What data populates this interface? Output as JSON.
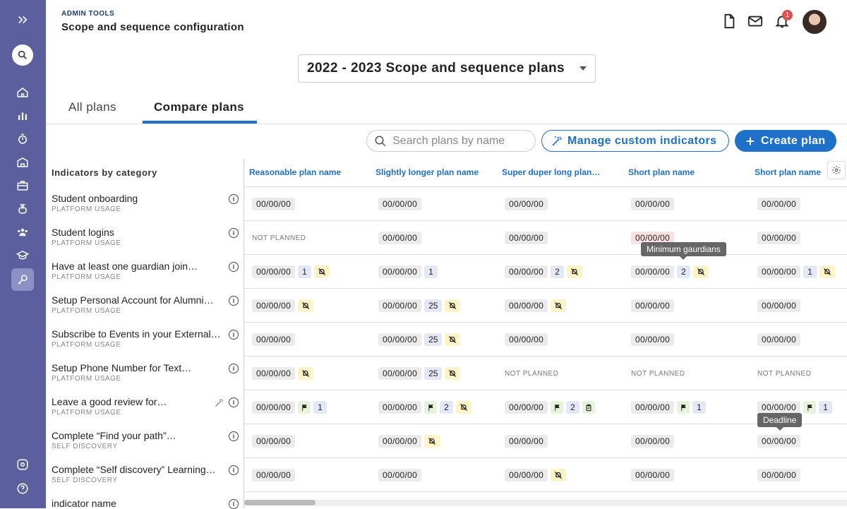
{
  "header": {
    "section": "ADMIN TOOLS",
    "title": "Scope and sequence configuration",
    "notification_count": "1"
  },
  "plan_selector": {
    "value": "2022 - 2023 Scope and sequence plans"
  },
  "tabs": [
    {
      "label": "All plans"
    },
    {
      "label": "Compare plans"
    }
  ],
  "toolbar": {
    "search_placeholder": "Search plans by name",
    "manage_label": "Manage custom indicators",
    "create_label": "Create plan"
  },
  "indicators_heading": "Indicators by category",
  "indicators": [
    {
      "name": "Student onboarding",
      "category": "PLATFORM USAGE"
    },
    {
      "name": "Student logins",
      "category": "PLATFORM USAGE"
    },
    {
      "name": "Have at least one guardian join…",
      "category": "PLATFORM USAGE"
    },
    {
      "name": "Setup Personal Account for Alumni…",
      "category": "PLATFORM USAGE"
    },
    {
      "name": "Subscribe to Events in your External…",
      "category": "PLATFORM USAGE"
    },
    {
      "name": "Setup Phone Number for Text…",
      "category": "PLATFORM USAGE"
    },
    {
      "name": "Leave a good review for…",
      "category": "PLATFORM USAGE"
    },
    {
      "name": "Complete “Find your path”…",
      "category": "SELF DISCOVERY"
    },
    {
      "name": "Complete “Self discovery” Learning…",
      "category": "SELF DISCOVERY"
    },
    {
      "name": "indicator name",
      "category": ""
    }
  ],
  "columns": [
    "Reasonable plan name",
    "Slightly longer plan name",
    "Super duper long plan…",
    "Short plan name",
    "Short plan name"
  ],
  "cells": {
    "date": "00/00/00",
    "not_planned": "NOT PLANNED",
    "n1": "1",
    "n2": "2",
    "n25": "25"
  },
  "tooltips": {
    "min_guardians": "Minimum gaurdians",
    "deadline": "Deadline"
  },
  "colors": {
    "sidebar": "#5b5f9e",
    "accent": "#1e70c8",
    "badge": "#d9534f"
  }
}
